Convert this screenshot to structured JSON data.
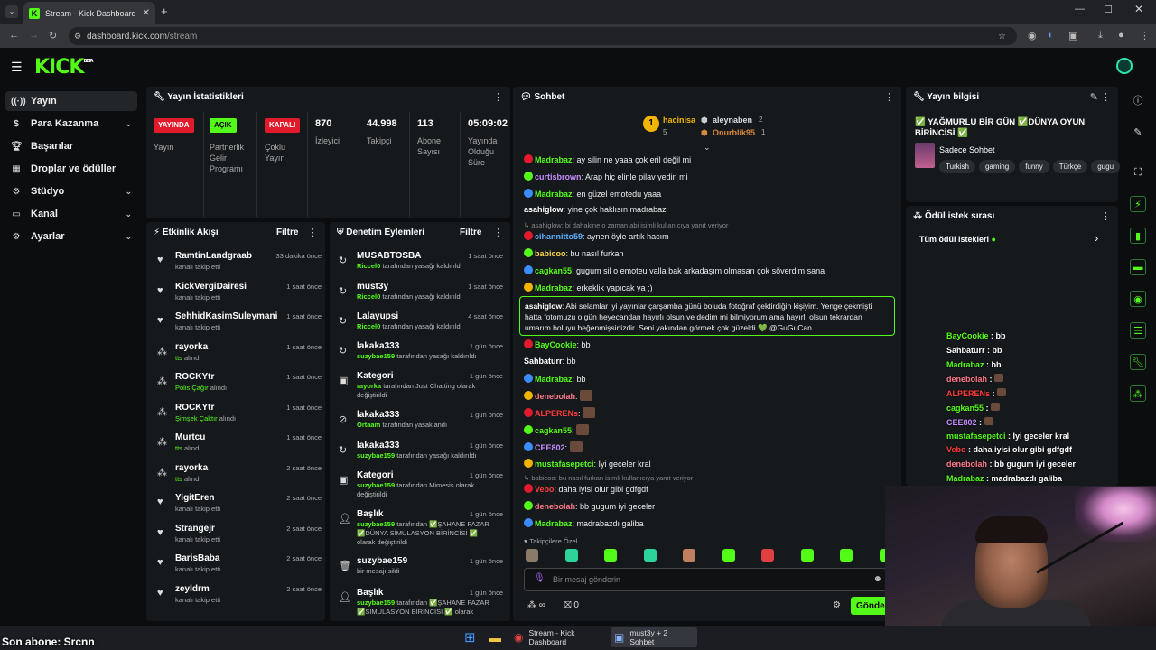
{
  "browser": {
    "tab_title": "Stream - Kick Dashboard",
    "url_host": "dashboard.kick.com",
    "url_path": "/stream"
  },
  "site": {
    "logo": "KICK",
    "logo_sup": "BETA"
  },
  "sidebar": {
    "items": [
      {
        "label": "Yayın",
        "icon": "live-icon",
        "active": true,
        "expand": false
      },
      {
        "label": "Para Kazanma",
        "icon": "money-icon",
        "active": false,
        "expand": true
      },
      {
        "label": "Başarılar",
        "icon": "trophy-icon",
        "active": false,
        "expand": false
      },
      {
        "label": "Droplar ve ödüller",
        "icon": "gift-icon",
        "active": false,
        "expand": false
      },
      {
        "label": "Stüdyo",
        "icon": "studio-icon",
        "active": false,
        "expand": true
      },
      {
        "label": "Kanal",
        "icon": "channel-icon",
        "active": false,
        "expand": true
      },
      {
        "label": "Ayarlar",
        "icon": "gear-icon",
        "active": false,
        "expand": true
      }
    ]
  },
  "stats": {
    "title": "Yayın İstatistikleri",
    "items": [
      {
        "badge": "YAYINDA",
        "label": "Yayın"
      },
      {
        "badge": "AÇIK",
        "label": "Partnerlik Gelir Programı"
      },
      {
        "badge": "KAPALI",
        "label": "Çoklu Yayın"
      },
      {
        "value": "870",
        "label": "İzleyici"
      },
      {
        "value": "44.998",
        "label": "Takipçi"
      },
      {
        "value": "113",
        "label": "Abone Sayısı"
      },
      {
        "value": "05:09:02",
        "label": "Yayında Olduğu Süre"
      }
    ]
  },
  "activity": {
    "title": "Etkinlik Akışı",
    "filter": "Filtre",
    "rows": [
      {
        "name": "RamtinLandgraab",
        "sub": "kanalı takip etti",
        "sub_green": "",
        "time": "33 dakika önce"
      },
      {
        "name": "KickVergiDairesi",
        "sub": "kanalı takip etti",
        "sub_green": "",
        "time": "1 saat önce"
      },
      {
        "name": "SehhidKasimSuleymani",
        "sub": "kanalı takip etti",
        "sub_green": "",
        "time": "1 saat önce"
      },
      {
        "name": "rayorka",
        "sub": "alındı",
        "sub_green": "tts",
        "time": "1 saat önce"
      },
      {
        "name": "ROCKYtr",
        "sub": "alındı",
        "sub_green": "Polis Çağır",
        "time": "1 saat önce"
      },
      {
        "name": "ROCKYtr",
        "sub": "alındı",
        "sub_green": "Şimşek Çaktır",
        "time": "1 saat önce"
      },
      {
        "name": "Murtcu",
        "sub": "alındı",
        "sub_green": "tts",
        "time": "1 saat önce"
      },
      {
        "name": "rayorka",
        "sub": "alındı",
        "sub_green": "tts",
        "time": "2 saat önce"
      },
      {
        "name": "YigitEren",
        "sub": "kanalı takip etti",
        "sub_green": "",
        "time": "2 saat önce"
      },
      {
        "name": "Strangejr",
        "sub": "kanalı takip etti",
        "sub_green": "",
        "time": "2 saat önce"
      },
      {
        "name": "BarisBaba",
        "sub": "kanalı takip etti",
        "sub_green": "",
        "time": "2 saat önce"
      },
      {
        "name": "zeyldrm",
        "sub": "kanalı takip etti",
        "sub_green": "",
        "time": "2 saat önce"
      }
    ]
  },
  "moderation": {
    "title": "Denetim Eylemleri",
    "filter": "Filtre",
    "rows": [
      {
        "name": "MUSABTOSBA",
        "actor": "Riccel0",
        "text": " tarafından yasağı kaldırıldı",
        "time": "1 saat önce"
      },
      {
        "name": "must3y",
        "actor": "Riccel0",
        "text": " tarafından yasağı kaldırıldı",
        "time": "1 saat önce"
      },
      {
        "name": "Lalayupsi",
        "actor": "Riccel0",
        "text": " tarafından yasağı kaldırıldı",
        "time": "4 saat önce"
      },
      {
        "name": "lakaka333",
        "actor": "suzybae159",
        "text": " tarafından yasağı kaldırıldı",
        "time": "1 gün önce"
      },
      {
        "name": "Kategori",
        "actor": "rayorka",
        "text": " tarafından Just Chatting olarak değiştirildi",
        "time": "1 gün önce"
      },
      {
        "name": "lakaka333",
        "actor": "Ortaam",
        "text": " tarafından yasaklandı",
        "time": "1 gün önce"
      },
      {
        "name": "lakaka333",
        "actor": "suzybae159",
        "text": " tarafından yasağı kaldırıldı",
        "time": "1 gün önce"
      },
      {
        "name": "Kategori",
        "actor": "suzybae159",
        "text": " tarafından Mimesis olarak değiştirildi",
        "time": "1 gün önce"
      },
      {
        "name": "Başlık",
        "actor": "suzybae159",
        "text": " tarafından ✅ŞAHANE PAZAR ✅DÜNYA SİMULASYON BİRİNCİSİ ✅ olarak değiştirildi",
        "time": "1 gün önce"
      },
      {
        "name": "suzybae159",
        "actor": "",
        "text": "bir mesajı sildi",
        "time": "1 gün önce"
      },
      {
        "name": "Başlık",
        "actor": "suzybae159",
        "text": " tarafından ✅ŞAHANE PAZAR ✅SIMULASYON BİRİNCİSİ ✅ olarak",
        "time": "1 gün önce"
      }
    ]
  },
  "chat": {
    "title": "Sohbet",
    "top_gifters": [
      {
        "name": "hacinisa",
        "count": "5"
      },
      {
        "name": "aleynaben",
        "count": "2"
      },
      {
        "name": "Onurblik95",
        "count": "1"
      }
    ],
    "messages": [
      {
        "user": "Madrabaz",
        "color": "#53fc18",
        "text": "ay silin ne yaaa çok eril değil mi"
      },
      {
        "user": "curtisbrown",
        "color": "#c58cff",
        "text": "Arap hiç elinle pilav yedin mi"
      },
      {
        "user": "Madrabaz",
        "color": "#53fc18",
        "text": "en güzel emotedu yaaa"
      },
      {
        "user": "asahiglow",
        "color": "#ffffff",
        "text": "yine çok haklısın madrabaz"
      },
      {
        "user": "cihannitto59",
        "color": "#5fb0ff",
        "text": "aynen öyle artık hacım",
        "reply": "asahiglow: bi dahakine o zaman abi isimli kullanıcıya yanıt veriyor"
      },
      {
        "user": "babicoo",
        "color": "#ffd84a",
        "text": "bu nasıl furkan"
      },
      {
        "user": "cagkan55",
        "color": "#53fc18",
        "text": "gugum sil o emoteu valla bak arkadaşım olmasan çok söverdim sana"
      },
      {
        "user": "Madrabaz",
        "color": "#53fc18",
        "text": "erkeklik yapıcak ya ;)"
      },
      {
        "user": "BayCookie",
        "color": "#53fc18",
        "text": "bb"
      },
      {
        "user": "Sahbaturr",
        "color": "#ffffff",
        "text": "bb"
      },
      {
        "user": "Madrabaz",
        "color": "#53fc18",
        "text": "bb"
      },
      {
        "user": "denebolah",
        "color": "#ff7a8c",
        "text": ""
      },
      {
        "user": "ALPERENs",
        "color": "#ff3b3b",
        "text": ""
      },
      {
        "user": "cagkan55",
        "color": "#53fc18",
        "text": ""
      },
      {
        "user": "CEE802",
        "color": "#c58cff",
        "text": ""
      },
      {
        "user": "mustafasepetci",
        "color": "#53fc18",
        "text": "İyi geceler kral"
      },
      {
        "user": "Vebo",
        "color": "#ff3b3b",
        "text": "daha iyisi olur gibi gdfgdf",
        "reply": "babicoo: bu nasıl furkan isimli kullanıcıya yanıt veriyor"
      },
      {
        "user": "denebolah",
        "color": "#ff7a8c",
        "text": "bb gugum iyi geceler"
      },
      {
        "user": "Madrabaz",
        "color": "#53fc18",
        "text": "madrabazdı galiba"
      }
    ],
    "highlight": {
      "user": "asahiglow",
      "text": "Abi selamlar iyi yayınlar çarşamba günü boluda fotoğraf çektirdiğin kişiyim. Yenge çekmişti hatta fotomuzu o gün heyecandan hayırlı olsun ve dedim mi bilmiyorum ama hayırlı olsun tekrardan umarım boluyu beğenmişsinizdir. Seni yakından görmek çok güzeldi 💚 @GuGuCan"
    },
    "followers_only": "Takipçilere Özel",
    "input_placeholder": "Bir mesaj gönderin",
    "send_label": "Gönder",
    "points": "∞",
    "gift_count": "0"
  },
  "stream_info": {
    "title": "Yayın bilgisi",
    "stream_title": "✅ YAĞMURLU BİR GÜN ✅DÜNYA OYUN BİRİNCİSİ ✅",
    "category": "Sadece Sohbet",
    "tags": [
      "Turkish",
      "gaming",
      "funny",
      "Türkçe",
      "gugu"
    ]
  },
  "rewards": {
    "title": "Ödül istek sırası",
    "all_label": "Tüm ödül istekleri"
  },
  "overlay_chat": [
    {
      "user": "BayCookie",
      "color": "#53fc18",
      "text": "bb"
    },
    {
      "user": "Sahbaturr",
      "color": "#ffffff",
      "text": "bb"
    },
    {
      "user": "Madrabaz",
      "color": "#53fc18",
      "text": "bb"
    },
    {
      "user": "denebolah",
      "color": "#ff7a8c",
      "text": ""
    },
    {
      "user": "ALPERENs",
      "color": "#ff3b3b",
      "text": ""
    },
    {
      "user": "cagkan55",
      "color": "#53fc18",
      "text": ""
    },
    {
      "user": "CEE802",
      "color": "#c58cff",
      "text": ""
    },
    {
      "user": "mustafasepetci",
      "color": "#53fc18",
      "text": "İyi geceler kral"
    },
    {
      "user": "Vebo",
      "color": "#ff3b3b",
      "text": "daha iyisi olur gibi gdfgdf"
    },
    {
      "user": "denebolah",
      "color": "#ff7a8c",
      "text": "bb gugum iyi geceler"
    },
    {
      "user": "Madrabaz",
      "color": "#53fc18",
      "text": "madrabazdı galiba"
    }
  ],
  "stream_overlay": {
    "last_sub": "Son abone: Srcnn"
  },
  "taskbar": {
    "app1": "Stream - Kick Dashboard",
    "app2": "must3y + 2 Sohbet"
  }
}
